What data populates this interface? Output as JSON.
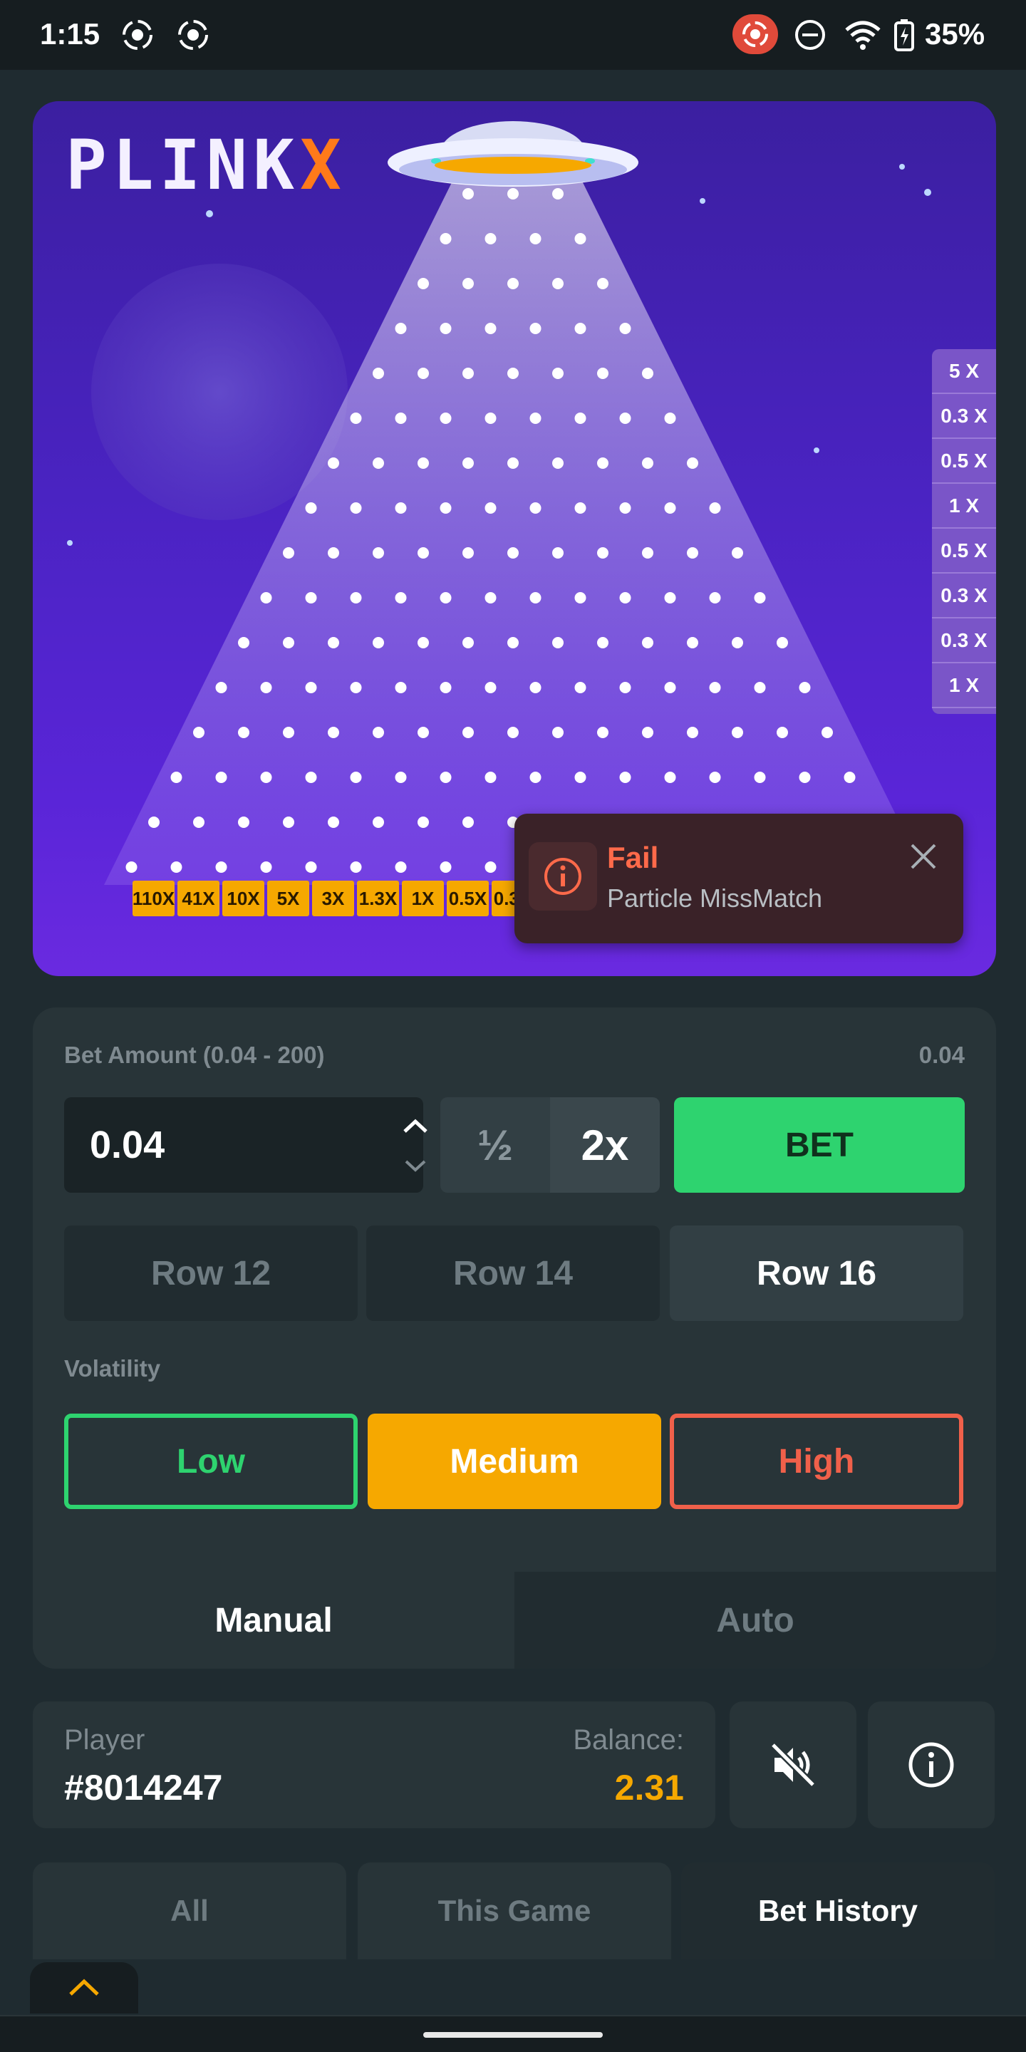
{
  "status_bar": {
    "time": "1:15",
    "battery": "35%"
  },
  "game": {
    "logo_main": "PLINK",
    "logo_accent": "X",
    "side_multipliers": [
      "5 X",
      "0.3 X",
      "0.5 X",
      "1 X",
      "0.5 X",
      "0.3 X",
      "0.3 X",
      "1 X"
    ],
    "buckets": [
      "110X",
      "41X",
      "10X",
      "5X",
      "3X",
      "1.3X",
      "1X",
      "0.5X",
      "0.3X"
    ]
  },
  "toast": {
    "title": "Fail",
    "message": "Particle MissMatch"
  },
  "bet": {
    "label": "Bet Amount (0.04 - 200)",
    "max_display": "0.04",
    "value": "0.04",
    "half_label": "½",
    "double_label": "2x",
    "bet_button": "BET"
  },
  "rows": {
    "options": [
      "Row 12",
      "Row 14",
      "Row 16"
    ],
    "selected": "Row 16"
  },
  "volatility": {
    "label": "Volatility",
    "low": "Low",
    "medium": "Medium",
    "high": "High",
    "selected": "Medium"
  },
  "mode": {
    "manual": "Manual",
    "auto": "Auto",
    "selected": "Manual"
  },
  "player": {
    "label": "Player",
    "id": "#8014247",
    "balance_label": "Balance:",
    "balance": "2.31"
  },
  "history_tabs": {
    "all": "All",
    "this_game": "This Game",
    "bet_history": "Bet History",
    "selected": "Bet History"
  },
  "colors": {
    "accent_green": "#2ed36f",
    "accent_orange": "#f6a800",
    "accent_red": "#f0604a",
    "panel": "#283438"
  },
  "icons": [
    "record-icon",
    "dnd-icon",
    "wifi-icon",
    "battery-icon",
    "info-icon",
    "close-icon",
    "mute-icon",
    "chevron-up-icon",
    "ufo-icon"
  ]
}
